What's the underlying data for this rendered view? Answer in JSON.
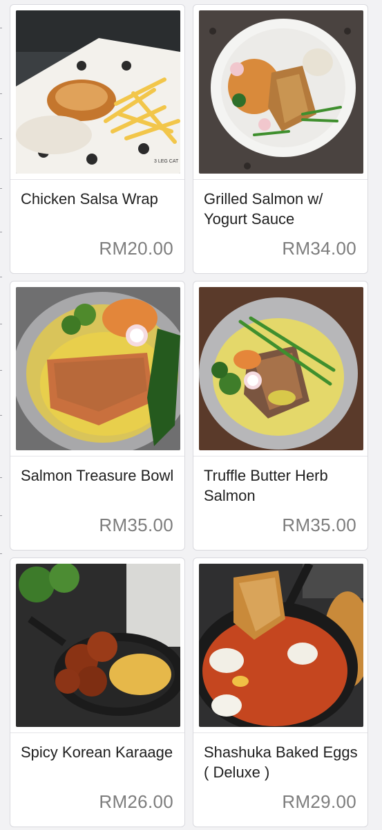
{
  "menu": {
    "items": [
      {
        "name": "Chicken Salsa Wrap",
        "price": "RM20.00",
        "photo_brand": "3 LEG CAT"
      },
      {
        "name": "Grilled Salmon w/ Yogurt Sauce",
        "price": "RM34.00"
      },
      {
        "name": "Salmon Treasure Bowl",
        "price": "RM35.00"
      },
      {
        "name": "Truffle Butter Herb Salmon",
        "price": "RM35.00"
      },
      {
        "name": "Spicy Korean Karaage",
        "price": "RM26.00"
      },
      {
        "name": "Shashuka Baked Eggs ( Deluxe )",
        "price": "RM29.00"
      }
    ]
  },
  "colors": {
    "page_bg": "#f2f2f4",
    "card_bg": "#ffffff",
    "name_text": "#1f1f1f",
    "price_text": "#7d7d7d"
  }
}
